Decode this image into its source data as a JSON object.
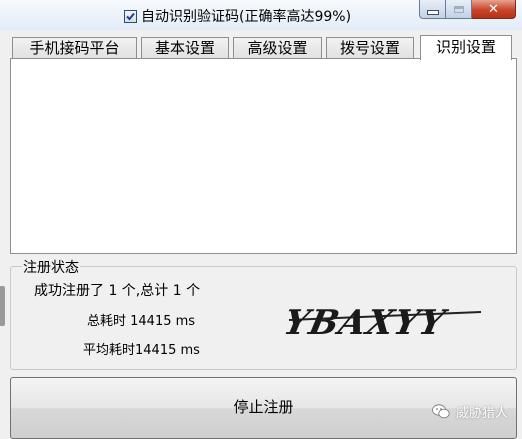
{
  "window": {
    "minimize_glyph": "minimize",
    "maximize_glyph": "maximize",
    "close_glyph": "x"
  },
  "tabs": [
    {
      "label": "手机接码平台",
      "active": false
    },
    {
      "label": "基本设置",
      "active": false
    },
    {
      "label": "高级设置",
      "active": false
    },
    {
      "label": "拨号设置",
      "active": false
    },
    {
      "label": "识别设置",
      "active": true
    }
  ],
  "recognition": {
    "auto_captcha_label": "自动识别验证码(正确率高达99%)",
    "auto_captcha_checked": true
  },
  "status": {
    "group_title": "注册状态",
    "summary": "成功注册了 1 个,总计 1 个",
    "total_time": "总耗时 14415 ms",
    "avg_time": "平均耗时14415 ms",
    "captcha_text": "YBAXYY"
  },
  "actions": {
    "stop_label": "停止注册"
  },
  "watermark": {
    "text": "威胁猎人",
    "icon": "wechat-icon"
  }
}
